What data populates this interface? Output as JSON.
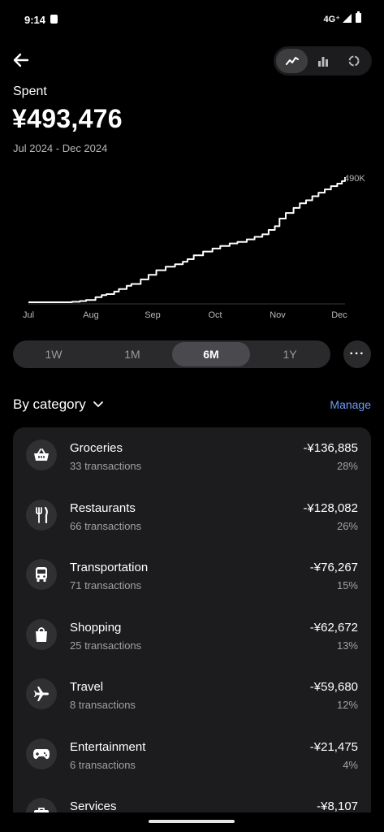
{
  "status_bar": {
    "time": "9:14",
    "network": "4G⁺"
  },
  "header": {
    "back_icon": "arrow-left-icon",
    "view_options": [
      {
        "icon": "line-chart-icon",
        "active": true
      },
      {
        "icon": "bar-chart-icon",
        "active": false
      },
      {
        "icon": "ring-chart-icon",
        "active": false
      }
    ]
  },
  "summary": {
    "label": "Spent",
    "amount": "¥493,476",
    "date_range": "Jul 2024 - Dec 2024"
  },
  "chart_data": {
    "type": "line",
    "x_ticks": [
      "Jul",
      "Aug",
      "Sep",
      "Oct",
      "Nov",
      "Dec"
    ],
    "end_label": "490K",
    "ylim": [
      0,
      493476
    ],
    "series": [
      {
        "values": [
          [
            0,
            0
          ],
          [
            14,
            0
          ],
          [
            26,
            0
          ],
          [
            28,
            2000
          ],
          [
            33,
            5000
          ],
          [
            37,
            9000
          ],
          [
            43,
            20000
          ],
          [
            47,
            28000
          ],
          [
            50,
            32000
          ],
          [
            55,
            42000
          ],
          [
            58,
            52000
          ],
          [
            63,
            65000
          ],
          [
            66,
            72000
          ],
          [
            72,
            90000
          ],
          [
            77,
            108000
          ],
          [
            82,
            126000
          ],
          [
            88,
            140000
          ],
          [
            94,
            150000
          ],
          [
            99,
            160000
          ],
          [
            102,
            170000
          ],
          [
            106,
            185000
          ],
          [
            112,
            200000
          ],
          [
            118,
            212000
          ],
          [
            123,
            222000
          ],
          [
            129,
            232000
          ],
          [
            134,
            238000
          ],
          [
            140,
            248000
          ],
          [
            145,
            258000
          ],
          [
            150,
            268000
          ],
          [
            154,
            285000
          ],
          [
            158,
            300000
          ],
          [
            161,
            330000
          ],
          [
            165,
            352000
          ],
          [
            170,
            372000
          ],
          [
            174,
            390000
          ],
          [
            178,
            402000
          ],
          [
            182,
            418000
          ],
          [
            186,
            432000
          ],
          [
            190,
            445000
          ],
          [
            194,
            458000
          ],
          [
            198,
            468000
          ],
          [
            201,
            478000
          ],
          [
            203,
            493476
          ]
        ]
      }
    ],
    "color": "#ffffff"
  },
  "ranges": {
    "options": [
      "1W",
      "1M",
      "6M",
      "1Y"
    ],
    "active": "6M",
    "more_icon": "more-horizontal-icon"
  },
  "category_section": {
    "title": "By category",
    "chevron_icon": "chevron-down-icon",
    "manage_label": "Manage",
    "items": [
      {
        "name": "Groceries",
        "count": "33 transactions",
        "amount": "-¥136,885",
        "percent": "28%",
        "icon": "basket-icon"
      },
      {
        "name": "Restaurants",
        "count": "66 transactions",
        "amount": "-¥128,082",
        "percent": "26%",
        "icon": "fork-knife-icon"
      },
      {
        "name": "Transportation",
        "count": "71 transactions",
        "amount": "-¥76,267",
        "percent": "15%",
        "icon": "bus-icon"
      },
      {
        "name": "Shopping",
        "count": "25 transactions",
        "amount": "-¥62,672",
        "percent": "13%",
        "icon": "shopping-bag-icon"
      },
      {
        "name": "Travel",
        "count": "8 transactions",
        "amount": "-¥59,680",
        "percent": "12%",
        "icon": "airplane-icon"
      },
      {
        "name": "Entertainment",
        "count": "6 transactions",
        "amount": "-¥21,475",
        "percent": "4%",
        "icon": "gamepad-icon"
      },
      {
        "name": "Services",
        "count": "",
        "amount": "-¥8,107",
        "percent": "",
        "icon": "briefcase-icon"
      }
    ]
  }
}
